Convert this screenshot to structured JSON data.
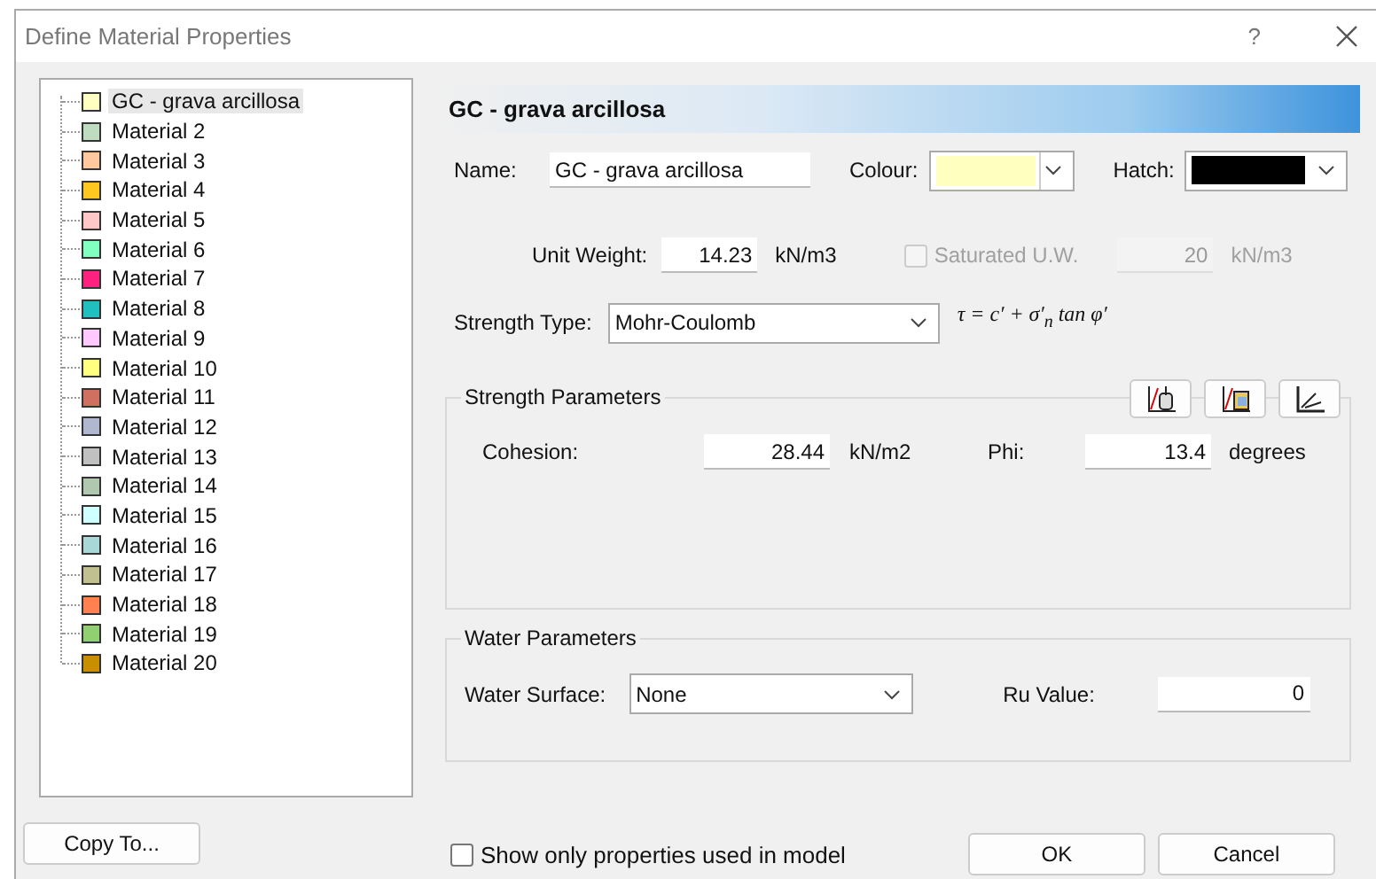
{
  "window": {
    "title": "Define Material Properties",
    "help": "?"
  },
  "materials": [
    {
      "label": "GC - grava arcillosa",
      "color": "#ffffc0",
      "selected": true
    },
    {
      "label": "Material 2",
      "color": "#c0dcc0",
      "selected": false
    },
    {
      "label": "Material 3",
      "color": "#ffc8a0",
      "selected": false
    },
    {
      "label": "Material 4",
      "color": "#ffc820",
      "selected": false
    },
    {
      "label": "Material 5",
      "color": "#ffc8c8",
      "selected": false
    },
    {
      "label": "Material 6",
      "color": "#80ffc0",
      "selected": false
    },
    {
      "label": "Material 7",
      "color": "#ff2080",
      "selected": false
    },
    {
      "label": "Material 8",
      "color": "#20c0c0",
      "selected": false
    },
    {
      "label": "Material 9",
      "color": "#ffc8ff",
      "selected": false
    },
    {
      "label": "Material 10",
      "color": "#ffff80",
      "selected": false
    },
    {
      "label": "Material 11",
      "color": "#d07060",
      "selected": false
    },
    {
      "label": "Material 12",
      "color": "#b0b8d0",
      "selected": false
    },
    {
      "label": "Material 13",
      "color": "#c0c0c0",
      "selected": false
    },
    {
      "label": "Material 14",
      "color": "#b0c8b0",
      "selected": false
    },
    {
      "label": "Material 15",
      "color": "#d0ffff",
      "selected": false
    },
    {
      "label": "Material 16",
      "color": "#a8d8d8",
      "selected": false
    },
    {
      "label": "Material 17",
      "color": "#c0c090",
      "selected": false
    },
    {
      "label": "Material 18",
      "color": "#ff8050",
      "selected": false
    },
    {
      "label": "Material 19",
      "color": "#90d070",
      "selected": false
    },
    {
      "label": "Material 20",
      "color": "#c89000",
      "selected": false
    }
  ],
  "header": "GC - grava arcillosa",
  "name": {
    "label": "Name:",
    "value": "GC - grava arcillosa"
  },
  "colour": {
    "label": "Colour:",
    "color": "#ffffc0"
  },
  "hatch": {
    "label": "Hatch:",
    "color": "#000000"
  },
  "unit_weight": {
    "label": "Unit Weight:",
    "value": "14.23",
    "unit": "kN/m3"
  },
  "saturated": {
    "label": "Saturated U.W.",
    "checked": false,
    "disabled": true,
    "value": "20",
    "unit": "kN/m3"
  },
  "strength_type": {
    "label": "Strength Type:",
    "value": "Mohr-Coulomb",
    "formula": "τ = c′ + σ′$_{n}$ tan φ′"
  },
  "strength_parameters": {
    "title": "Strength Parameters",
    "cohesion": {
      "label": "Cohesion:",
      "value": "28.44",
      "unit": "kN/m2"
    },
    "phi": {
      "label": "Phi:",
      "value": "13.4",
      "unit": "degrees"
    }
  },
  "water_parameters": {
    "title": "Water Parameters",
    "surface": {
      "label": "Water Surface:",
      "value": "None"
    },
    "ru": {
      "label": "Ru Value:",
      "value": "0"
    }
  },
  "copy_button": "Copy To...",
  "show_only": {
    "label": "Show only properties used in model",
    "checked": false
  },
  "buttons": [
    "OK",
    "Cancel"
  ]
}
